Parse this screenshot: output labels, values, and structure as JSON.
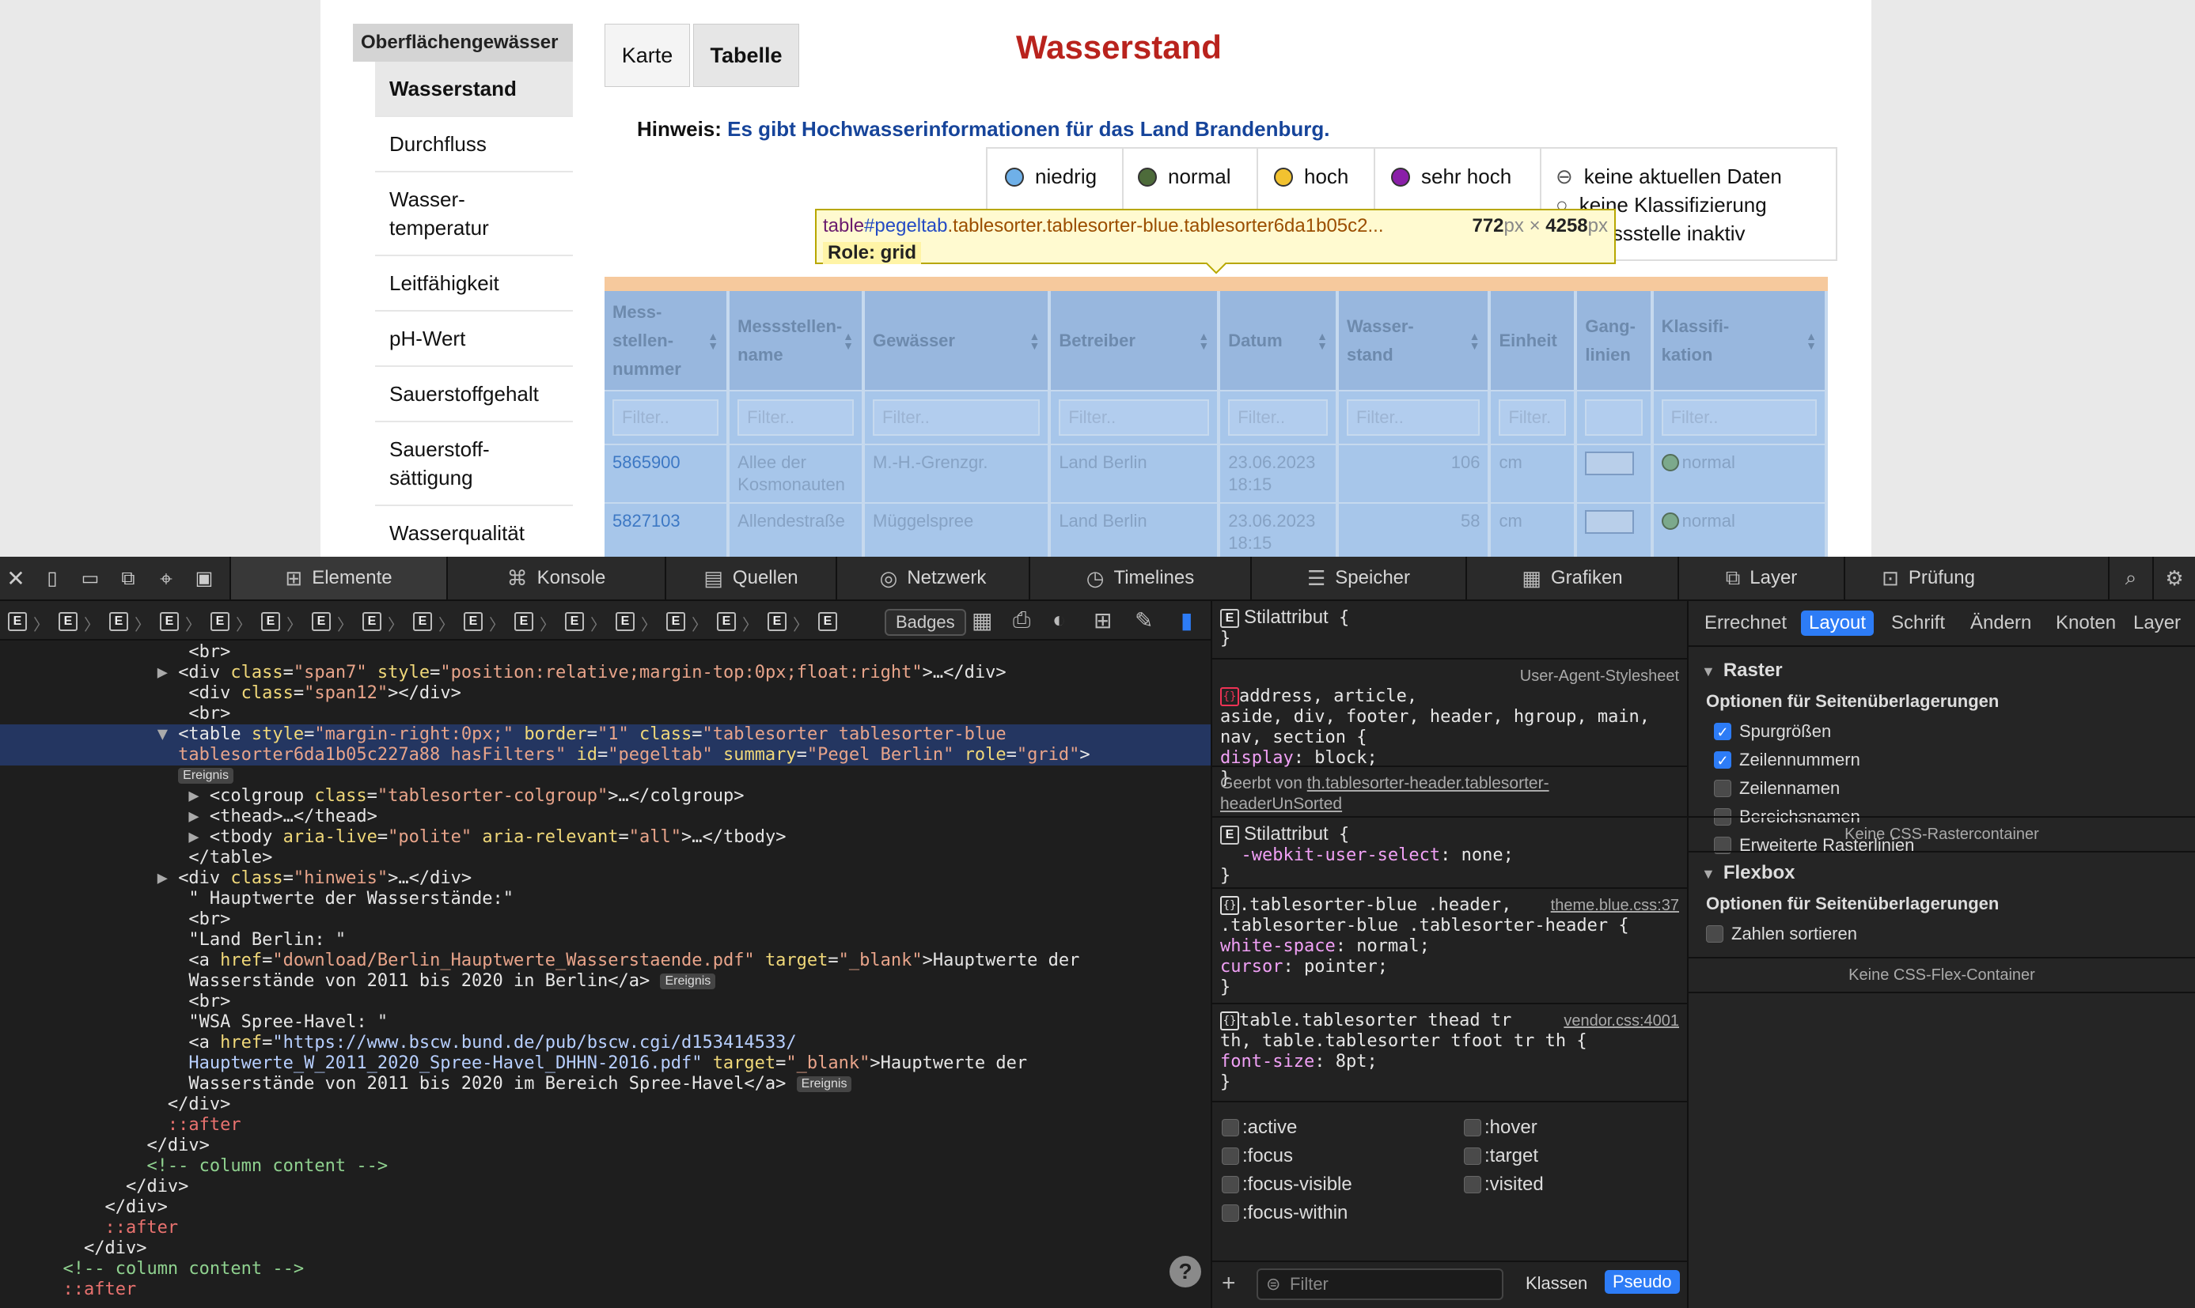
{
  "website": {
    "sidebar": {
      "header": "Oberflächengewässer",
      "items": [
        {
          "label": "Wasserstand",
          "active": true
        },
        {
          "label": "Durchfluss"
        },
        {
          "label": "Wasser-\ntemperatur"
        },
        {
          "label": "Leitfähigkeit"
        },
        {
          "label": "pH-Wert"
        },
        {
          "label": "Sauerstoffgehalt"
        },
        {
          "label": "Sauerstoff-\nsättigung"
        },
        {
          "label": "Wasserqualität"
        }
      ]
    },
    "tabs": {
      "karte": "Karte",
      "tabelle": "Tabelle"
    },
    "title": "Wasserstand",
    "hint_label": "Hinweis:",
    "hint_text": "Es gibt Hochwasserinformationen für das Land Brandenburg.",
    "legend": [
      {
        "label": "niedrig",
        "color": "#6fb0e8"
      },
      {
        "label": "normal",
        "color": "#4d6b3a"
      },
      {
        "label": "hoch",
        "color": "#f2c230"
      },
      {
        "label": "sehr hoch",
        "color": "#8a1fa8"
      }
    ],
    "legend_status": {
      "no_data": "keine aktuellen Daten",
      "no_class": "keine Klassifizierung",
      "inactive": "Messstelle inaktiv"
    },
    "tooltip": {
      "tag": "table",
      "id": "#pegeltab",
      "classes": ".tablesorter.tablesorter-blue.tablesorter6da1b05c2...",
      "width": "772",
      "height": "4258",
      "unit": "px",
      "times": "×",
      "role": "Role: grid"
    },
    "table": {
      "headers": [
        "Mess-\nstellen-\nnummer",
        "Messstellen-\nname",
        "Gewässer",
        "Betreiber",
        "Datum",
        "Wasser-\nstand",
        "Einheit",
        "Gang-\nlinien",
        "Klassifi-\nkation"
      ],
      "filter_placeholder": "Filter..",
      "einheit_filter": "Filter.",
      "rows": [
        {
          "nummer": "5865900",
          "name": "Allee der Kosmonauten",
          "gewaesser": "M.-H.-Grenzgr.",
          "betreiber": "Land Berlin",
          "datum": "23.06.2023\n18:15",
          "stand": "106",
          "einheit": "cm",
          "klasse": "normal"
        },
        {
          "nummer": "5827103",
          "name": "Allendestraße",
          "gewaesser": "Müggelspree",
          "betreiber": "Land Berlin",
          "datum": "23.06.2023\n18:15",
          "stand": "58",
          "einheit": "cm",
          "klasse": "normal"
        }
      ]
    }
  },
  "devtools": {
    "tabs": [
      {
        "label": "Elemente",
        "icon": "elements-icon"
      },
      {
        "label": "Konsole",
        "icon": "console-icon"
      },
      {
        "label": "Quellen",
        "icon": "sources-icon"
      },
      {
        "label": "Netzwerk",
        "icon": "network-icon"
      },
      {
        "label": "Timelines",
        "icon": "timelines-icon"
      },
      {
        "label": "Speicher",
        "icon": "storage-icon"
      },
      {
        "label": "Grafiken",
        "icon": "graphics-icon"
      },
      {
        "label": "Layer",
        "icon": "layers-icon"
      },
      {
        "label": "Prüfung",
        "icon": "audit-icon"
      }
    ],
    "badges": "Badges",
    "breadcrumb_letter": "E",
    "ereignis": "Ereignis",
    "dom": {
      "br": "<br>",
      "span7_open": "<div ",
      "span7_attr1": "class",
      "span7_val1": "\"span7\"",
      "span7_attr2": "style",
      "span7_val2": "\"position:relative;margin-top:0px;float:right\"",
      "span7_close": ">…</div>",
      "span12_open": "<div ",
      "span12_val": "\"span12\"",
      "span12_close": "></div>",
      "table_line1a": "<table ",
      "table_line1b": "style",
      "table_line1c": "\"margin-right:0px;\"",
      "table_line1d": "border",
      "table_line1e": "\"1\"",
      "table_line1f": "class",
      "table_line1g": "\"tablesorter tablesorter-blue",
      "table_line2a": "tablesorter6da1b05c227a88 hasFilters\"",
      "table_line2b": "id",
      "table_line2c": "\"pegeltab\"",
      "table_line2d": "summary",
      "table_line2e": "\"Pegel Berlin\"",
      "table_line2f": "role",
      "table_line2g": "\"grid\"",
      "colgroup_a": "<colgroup ",
      "colgroup_b": "class",
      "colgroup_c": "\"tablesorter-colgroup\"",
      "colgroup_d": ">…</colgroup>",
      "thead": "<thead>…</thead>",
      "tbody_a": "<tbody ",
      "tbody_b": "aria-live",
      "tbody_c": "\"polite\"",
      "tbody_d": "aria-relevant",
      "tbody_e": "\"all\"",
      "tbody_f": ">…</tbody>",
      "table_close": "</table>",
      "hinweis_a": "<div ",
      "hinweis_b": "class",
      "hinweis_c": "\"hinweis\"",
      "hinweis_d": ">…</div>",
      "text1": "\" Hauptwerte der Wasserstände:\"",
      "text2": "\"Land Berlin: \"",
      "a1_a": "<a ",
      "a1_b": "href",
      "a1_c": "\"download/Berlin_Hauptwerte_Wasserstaende.pdf\"",
      "a1_d": "target",
      "a1_e": "\"_blank\"",
      "a1_f": ">Hauptwerte der",
      "a1_g": "Wasserstände von 2011 bis 2020 in Berlin</a>",
      "text3": "\"WSA Spree-Havel: \"",
      "a2_a": "<a ",
      "a2_b": "href",
      "a2_c": "\"https://www.bscw.bund.de/pub/bscw.cgi/d153414533/",
      "a2_d": "Hauptwerte_W_2011_2020_Spree-Havel_DHHN-2016.pdf\"",
      "a2_e": "target",
      "a2_f": "\"_blank\"",
      "a2_g": ">Hauptwerte der",
      "a2_h": "Wasserstände von 2011 bis 2020 im Bereich Spree-Havel</a>",
      "div_close": "</div>",
      "after": "::after",
      "comment": "<!-- column content -->"
    },
    "styles": {
      "stilattribut": "Stilattribut",
      "open_brace": "{",
      "close_brace": "}",
      "ua_selector": "address, article,\naside, div, footer, header, hgroup, main,\nnav, section",
      "ua_source": "User-Agent-Stylesheet",
      "display_prop": "display",
      "display_val": "block;",
      "inherited_label": "Geerbt von",
      "inherited_link": "th.tablesorter-header.tablesorter-\nheaderUnSorted",
      "user_select_prop": "-webkit-user-select",
      "user_select_val": "none;",
      "theme_selector": ".tablesorter-blue .header,\n.tablesorter-blue .tablesorter-header",
      "theme_source": "theme.blue.css:37",
      "ws_prop": "white-space",
      "ws_val": "normal;",
      "cursor_prop": "cursor",
      "cursor_val": "pointer;",
      "vendor_selector": "table.tablesorter thead tr\nth, table.tablesorter tfoot tr th",
      "vendor_source": "vendor.css:4001",
      "fs_prop": "font-size",
      "fs_val": "8pt;",
      "pseudo_left": [
        ":active",
        ":focus",
        ":focus-visible",
        ":focus-within"
      ],
      "pseudo_right": [
        ":hover",
        ":target",
        ":visited"
      ],
      "filter_placeholder": "Filter",
      "klassen": "Klassen",
      "pseudo": "Pseudo"
    },
    "right_panel": {
      "tabs": [
        "Errechnet",
        "Layout",
        "Schrift",
        "Ändern",
        "Knoten",
        "Layer"
      ],
      "raster_title": "Raster",
      "options_title": "Optionen für Seitenüberlagerungen",
      "raster_options": [
        {
          "label": "Spurgrößen",
          "checked": true
        },
        {
          "label": "Zeilennummern",
          "checked": true
        },
        {
          "label": "Zeilennamen",
          "checked": false
        },
        {
          "label": "Bereichsnamen",
          "checked": false
        },
        {
          "label": "Erweiterte Rasterlinien",
          "checked": false
        }
      ],
      "no_grid": "Keine CSS-Rastercontainer",
      "flex_title": "Flexbox",
      "flex_options_title": "Optionen für Seitenüberlagerungen",
      "flex_option": "Zahlen sortieren",
      "no_flex": "Keine CSS-Flex-Container"
    }
  }
}
